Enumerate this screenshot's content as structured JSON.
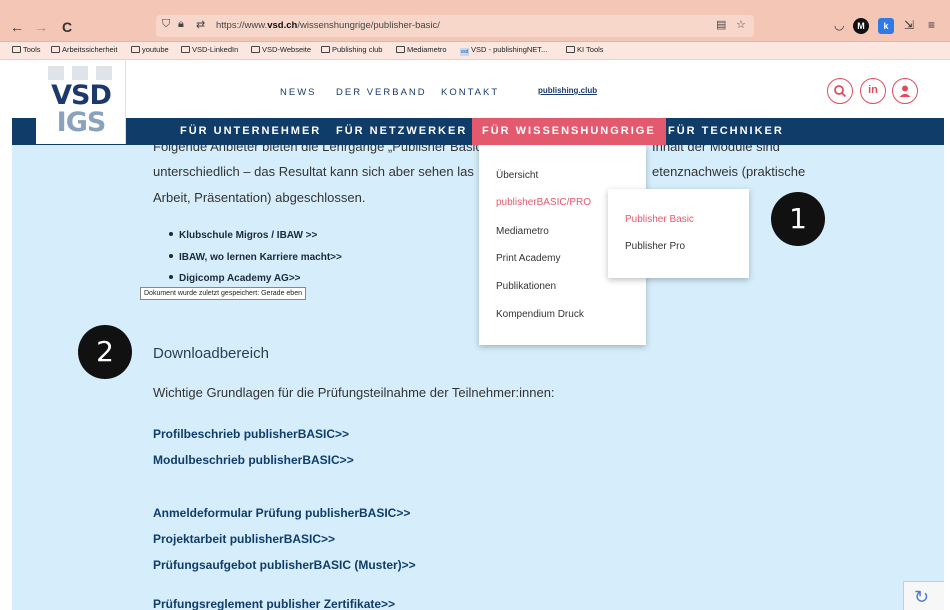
{
  "browser": {
    "back": "←",
    "forward": "→",
    "reload": "C",
    "url_prefix": "https://www.",
    "url_domain": "vsd.ch",
    "url_path": "/wissenshungrige/publisher-basic/",
    "menu": "≡"
  },
  "bookmarks": [
    "Tools",
    "Arbeitssicherheit",
    "youtube",
    "VSD-LinkedIn",
    "VSD-Webseite",
    "Publishing club",
    "Mediametro",
    "VSD - publishingNET...",
    "KI Tools"
  ],
  "logo": {
    "top": "VSD",
    "bottom": "IGS"
  },
  "topnav": {
    "news": "NEWS",
    "verband": "DER VERBAND",
    "kontakt": "KONTAKT",
    "pubclub": "publishing.club"
  },
  "social": {
    "linkedin": "in"
  },
  "mainnav": {
    "unternehmer": "FÜR UNTERNEHMER",
    "netzwerker": "FÜR NETZWERKER",
    "wissenshungrige": "FÜR WISSENSHUNGRIGE",
    "techniker": "FÜR TECHNIKER"
  },
  "content": {
    "line1_left": "Folgende Anbieter bieten die Lehrgänge „Publisher Basic",
    "line1_right": "Inhalt der Module sind",
    "line2_left": "unterschiedlich – das Resultat kann sich aber sehen las",
    "line2_right": "etenznachweis (praktische",
    "line3": "Arbeit, Präsentation) abgeschlossen.",
    "bullets": [
      "Klubschule Migros / IBAW >>",
      "IBAW,  wo lernen Karriere macht>>",
      "Digicomp Academy AG>>"
    ],
    "tooltip": "Dokument wurde zuletzt gespeichert: Gerade eben",
    "download_heading": "Downloadbereich",
    "intro": "Wichtige Grundlagen für die Prüfungsteilnahme der Teilnehmer:innen:",
    "links": [
      "Profilbeschrieb publisherBASIC>>",
      "Modulbeschrieb publisherBASIC>>",
      "Anmeldeformular Prüfung publisherBASIC>>",
      "Projektarbeit publisherBASIC>>",
      "Prüfungsaufgebot publisherBASIC (Muster)>>",
      "Prüfungsreglement  publisher Zertifikate>>"
    ]
  },
  "dropdown": [
    "Übersicht",
    "publisherBASIC/PRO",
    "Mediametro",
    "Print Academy",
    "Publikationen",
    "Kompendium Druck"
  ],
  "submenu": [
    "Publisher Basic",
    "Publisher Pro"
  ],
  "badges": {
    "one": "1",
    "two": "2"
  },
  "colors": {
    "navy": "#0f3c69",
    "accent": "#e35a6e",
    "content_bg": "#d6eefc",
    "chrome": "#f4c6b6"
  }
}
